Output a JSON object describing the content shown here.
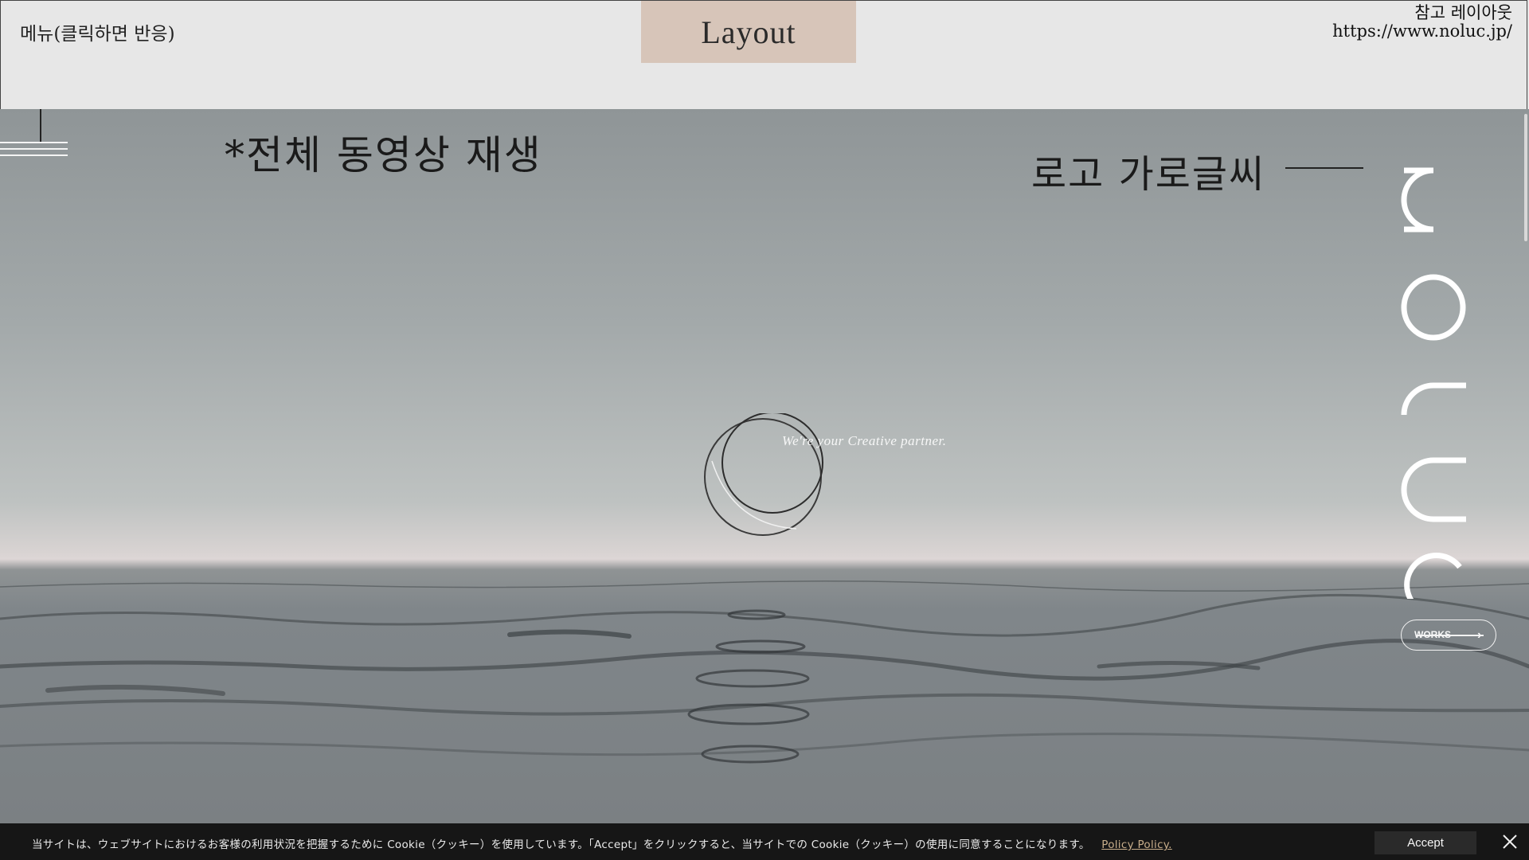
{
  "header": {
    "menu_note": "메뉴(클릭하면 반응)",
    "layout_tab": "Layout",
    "reference_label": "참고 레이아웃",
    "reference_url": "https://www.noluc.jp/"
  },
  "hero": {
    "video_note": "*전체 동영상 재생",
    "logo_note": "로고 가로글씨",
    "tagline": "We're your  Creative partner.",
    "vertical_logo_letters": "noluc",
    "works_button": "WORKS",
    "menu_icon": "hamburger-icon",
    "center_icon": "interlocking-circles-icon"
  },
  "cookie_banner": {
    "text": "当サイトは、ウェブサイトにおけるお客様の利用状況を把握するために Cookie（クッキー）を使用しています。「Accept」をクリックすると、当サイトでの Cookie（クッキー）の使用に同意することになります。",
    "policy_link": "Policy Policy.",
    "accept_label": "Accept",
    "close_icon": "close-icon"
  },
  "colors": {
    "layout_tab_bg": "#d7c5b9",
    "cookie_bg": "#161616",
    "policy_link": "#c7ad8a"
  }
}
